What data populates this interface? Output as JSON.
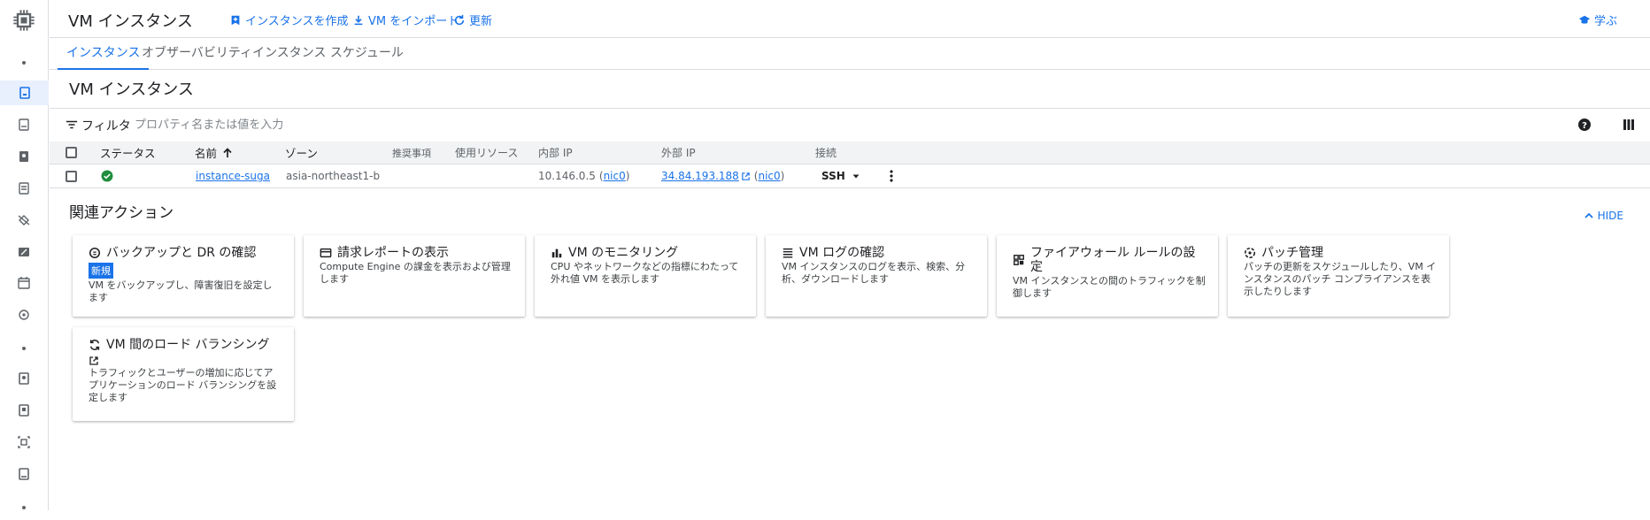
{
  "header": {
    "title": "VM インスタンス",
    "actions": [
      {
        "label": "インスタンスを作成",
        "icon": "add-box-icon"
      },
      {
        "label": "VM をインポート",
        "icon": "download-icon"
      },
      {
        "label": "更新",
        "icon": "refresh-icon"
      }
    ],
    "learn_label": "学ぶ"
  },
  "tabs": [
    {
      "label": "インスタンス",
      "active": true
    },
    {
      "label": "オブザーバビリティ",
      "active": false
    },
    {
      "label": "インスタンス スケジュール",
      "active": false
    }
  ],
  "section_title": "VM インスタンス",
  "filter": {
    "label": "フィルタ",
    "placeholder": "プロパティ名または値を入力"
  },
  "table": {
    "headers": [
      "ステータス",
      "名前",
      "ゾーン",
      "推奨事項",
      "使用リソース",
      "内部 IP",
      "外部 IP",
      "接続"
    ],
    "rows": [
      {
        "name": "instance-suga",
        "zone": "asia-northeast1-b",
        "internal_ip": "10.146.0.5",
        "internal_nic": "nic0",
        "external_ip": "34.84.193.188",
        "external_nic": "nic0",
        "connect": "SSH"
      }
    ]
  },
  "related": {
    "title": "関連アクション",
    "hide_label": "HIDE",
    "cards": [
      {
        "title": "バックアップと DR の確認",
        "badge": "新規",
        "desc": "VM をバックアップし、障害復旧を設定します",
        "icon": "backup-icon"
      },
      {
        "title": "請求レポートの表示",
        "desc": "Compute Engine の課金を表示および管理します",
        "icon": "billing-card-icon"
      },
      {
        "title": "VM のモニタリング",
        "desc": "CPU やネットワークなどの指標にわたって外れ値 VM を表示します",
        "icon": "bar-chart-icon"
      },
      {
        "title": "VM ログの確認",
        "desc": "VM インスタンスのログを表示、検索、分析、ダウンロードします",
        "icon": "logs-icon"
      },
      {
        "title": "ファイアウォール ルールの設定",
        "desc": "VM インスタンスとの間のトラフィックを制御します",
        "icon": "firewall-icon"
      },
      {
        "title": "パッチ管理",
        "desc": "パッチの更新をスケジュールしたり、VM インスタンスのパッチ コンプライアンスを表示したりします",
        "icon": "patch-icon"
      },
      {
        "title": "VM 間のロード バランシング",
        "desc": "トラフィックとユーザーの増加に応じてアプリケーションのロード バランシングを設定します",
        "icon": "load-balancing-icon"
      }
    ]
  },
  "colors": {
    "accent": "#1a73e8",
    "running": "#1e8e3e",
    "header_bg": "#f1f3f4"
  }
}
